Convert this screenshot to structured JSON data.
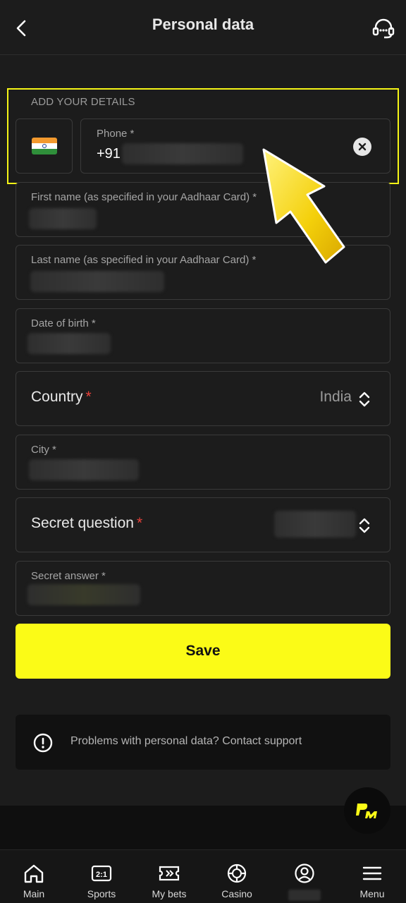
{
  "header": {
    "title": "Personal data"
  },
  "form": {
    "section_label": "ADD YOUR DETAILS",
    "phone": {
      "label": "Phone *",
      "value": "+91"
    },
    "first_name": {
      "label": "First name (as specified in your Aadhaar Card) *"
    },
    "last_name": {
      "label": "Last name (as specified in your Aadhaar Card) *"
    },
    "dob": {
      "label": "Date of birth *"
    },
    "country": {
      "label": "Country",
      "required_mark": "*",
      "value": "India"
    },
    "city": {
      "label": "City *"
    },
    "secret_question": {
      "label": "Secret question",
      "required_mark": "*"
    },
    "secret_answer": {
      "label": "Secret answer *"
    },
    "save_label": "Save"
  },
  "info": {
    "text": "Problems with personal data? Contact support"
  },
  "tabbar": {
    "items": [
      {
        "label": "Main",
        "icon": "home-icon"
      },
      {
        "label": "Sports",
        "icon": "scoreboard-icon"
      },
      {
        "label": "My bets",
        "icon": "ticket-icon"
      },
      {
        "label": "Casino",
        "icon": "chip-icon"
      },
      {
        "label": "",
        "icon": "profile-icon"
      },
      {
        "label": "Menu",
        "icon": "hamburger-icon"
      }
    ]
  },
  "colors": {
    "accent": "#fbfb17",
    "background": "#1c1c1c",
    "required": "#e8413a"
  }
}
